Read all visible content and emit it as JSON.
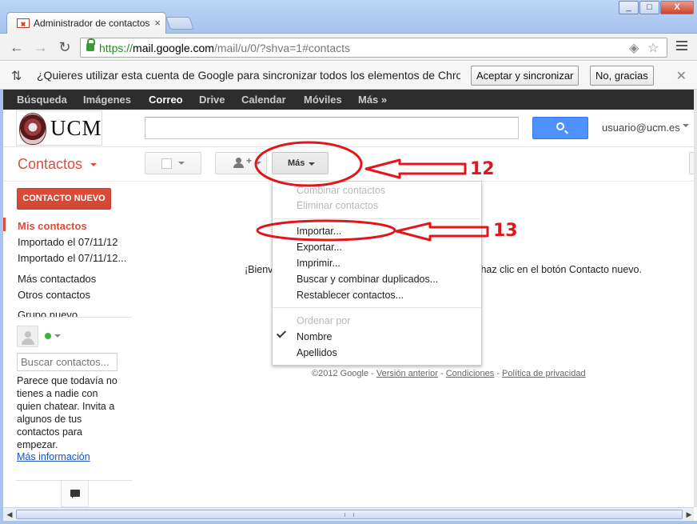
{
  "browser": {
    "tab_title": "Administrador de contactos -",
    "url_scheme": "https://",
    "url_host": "mail.google.com",
    "url_path": "/mail/u/0/?shva=1#contacts",
    "win_minimize": "_",
    "win_maximize": "□",
    "win_close": "X"
  },
  "infobar": {
    "message": "¿Quieres utilizar esta cuenta de Google para sincronizar todos los elementos de Chro...",
    "accept_label": "Aceptar y sincronizar",
    "decline_label": "No, gracias"
  },
  "google_bar": {
    "items": [
      "Búsqueda",
      "Imágenes",
      "Correo",
      "Drive",
      "Calendar",
      "Móviles",
      "Más »"
    ]
  },
  "header": {
    "logo_text": "UCM",
    "user_email": "usuario@ucm.es"
  },
  "contacts_toolbar": {
    "app_title": "Contactos",
    "more_label": "Más"
  },
  "sidebar": {
    "new_contact_label": "CONTACTO NUEVO",
    "items": [
      "Mis contactos",
      "Importado el 07/11/12",
      "Importado el 07/11/12...",
      "Más contactados",
      "Otros contactos",
      "Grupo nuevo..."
    ],
    "chat_search_placeholder": "Buscar contactos...",
    "chat_message": "Parece que todavía no tienes a nadie con quien chatear. Invita a algunos de tus contactos para empezar.",
    "more_info_link": "Más información"
  },
  "main": {
    "welcome_left": "¡Bienv",
    "welcome_right": "haz clic en el botón Contacto nuevo.",
    "footer_copyright": "©2012 Google",
    "footer_links": [
      "Versión anterior",
      "Condiciones",
      "Política de privacidad"
    ],
    "footer_sep": " - "
  },
  "dropdown_menu": {
    "items": [
      {
        "label": "Combinar contactos",
        "enabled": false
      },
      {
        "label": "Eliminar contactos",
        "enabled": false
      },
      {
        "label": "Importar...",
        "enabled": true
      },
      {
        "label": "Exportar...",
        "enabled": true
      },
      {
        "label": "Imprimir...",
        "enabled": true
      },
      {
        "label": "Buscar y combinar duplicados...",
        "enabled": true
      },
      {
        "label": "Restablecer contactos...",
        "enabled": true
      }
    ],
    "sort_header": "Ordenar por",
    "sort_options": [
      {
        "label": "Nombre",
        "selected": true
      },
      {
        "label": "Apellidos",
        "selected": false
      }
    ]
  },
  "annotations": {
    "step_more": "12",
    "step_import": "13"
  },
  "colors": {
    "accent_red": "#dd4b39",
    "search_blue": "#4d90fe",
    "annotation_red": "#e4141b",
    "gbar_dark": "#2d2d2d",
    "link_blue": "#1155cc"
  }
}
